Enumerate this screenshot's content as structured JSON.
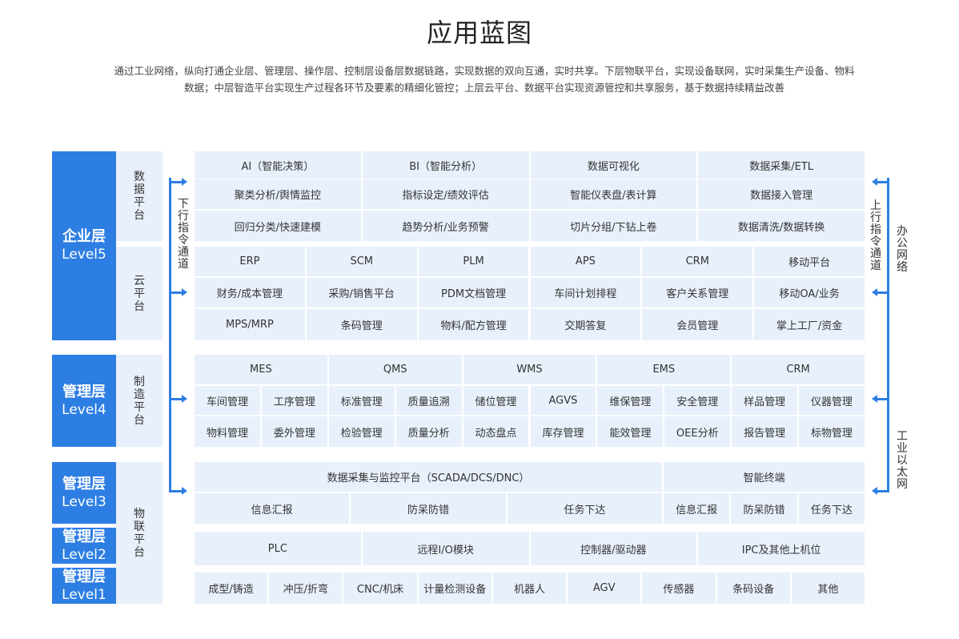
{
  "title": "应用蓝图",
  "description": [
    "通过工业网络，纵向打通企业层、管理层、操作层、控制层设备层数据链路，实现数据的双向互通，实时共享。下层物联平台，实现设备联网，实时采集生产设备、物料",
    "数据；中层智造平台实现生产过程各环节及要素的精细化管控；上层云平台、数据平台实现资源管控和共享服务，基于数据持续精益改善"
  ],
  "levels": [
    {
      "name": "企业层",
      "code": "Level5"
    },
    {
      "name": "管理层",
      "code": "Level4"
    },
    {
      "name": "管理层",
      "code": "Level3"
    },
    {
      "name": "管理层",
      "code": "Level2"
    },
    {
      "name": "管理层",
      "code": "Level1"
    }
  ],
  "platforms": [
    "数据平台",
    "云平台",
    "制造平台",
    "物联平台"
  ],
  "channels": {
    "down": "下行指令通道",
    "up": "上行指令通道",
    "office": "办公网络",
    "ethernet": "工业以太网"
  },
  "colors": {
    "accent": "#2d7ee3",
    "cell_bg": "#e8f0fb"
  },
  "data_platform": [
    [
      "AI（智能决策）",
      "BI（智能分析）",
      "数据可视化",
      "数据采集/ETL"
    ],
    [
      "聚类分析/舆情监控",
      "指标设定/绩效评估",
      "智能仪表盘/表计算",
      "数据接入管理"
    ],
    [
      "回归分类/快速建模",
      "趋势分析/业务预警",
      "切片分组/下钻上卷",
      "数据清洗/数据转换"
    ]
  ],
  "cloud_platform": [
    [
      "ERP",
      "SCM",
      "PLM",
      "APS",
      "CRM",
      "移动平台"
    ],
    [
      "财务/成本管理",
      "采购/销售平台",
      "PDM文档管理",
      "车间计划排程",
      "客户关系管理",
      "移动OA/业务"
    ],
    [
      "MPS/MRP",
      "条码管理",
      "物料/配方管理",
      "交期答复",
      "会员管理",
      "掌上工厂/资金"
    ]
  ],
  "mfg_platform": {
    "header": [
      "MES",
      "QMS",
      "WMS",
      "EMS",
      "CRM"
    ],
    "rows": [
      [
        "车间管理",
        "工序管理",
        "标准管理",
        "质量追溯",
        "储位管理",
        "AGVS",
        "维保管理",
        "安全管理",
        "样品管理",
        "仪器管理"
      ],
      [
        "物料管理",
        "委外管理",
        "检验管理",
        "质量分析",
        "动态盘点",
        "库存管理",
        "能效管理",
        "OEE分析",
        "报告管理",
        "标物管理"
      ]
    ]
  },
  "iot_platform": {
    "scada": "数据采集与监控平台（SCADA/DCS/DNC）",
    "terminal": "智能终端",
    "scada_items": [
      "信息汇报",
      "防呆防错",
      "任务下达"
    ],
    "terminal_items": [
      "信息汇报",
      "防呆防错",
      "任务下达"
    ],
    "control": [
      "PLC",
      "远程I/O模块",
      "控制器/驱动器",
      "IPC及其他上机位"
    ],
    "devices": [
      "成型/铸造",
      "冲压/折弯",
      "CNC/机床",
      "计量检测设备",
      "机器人",
      "AGV",
      "传感器",
      "条码设备",
      "其他"
    ]
  }
}
